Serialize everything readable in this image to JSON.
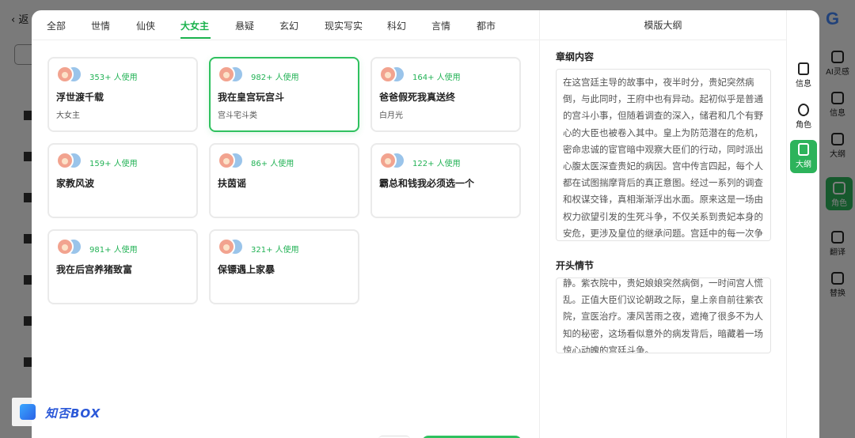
{
  "background": {
    "back_label": "返",
    "google_letter": "G",
    "rail": [
      {
        "label": "AI灵感"
      },
      {
        "label": "信息"
      },
      {
        "label": "大纲"
      },
      {
        "label": "角色"
      },
      {
        "label": "翻译"
      },
      {
        "label": "替换"
      }
    ]
  },
  "tabs": [
    {
      "label": "全部"
    },
    {
      "label": "世情"
    },
    {
      "label": "仙侠"
    },
    {
      "label": "大女主"
    },
    {
      "label": "悬疑"
    },
    {
      "label": "玄幻"
    },
    {
      "label": "现实写实"
    },
    {
      "label": "科幻"
    },
    {
      "label": "言情"
    },
    {
      "label": "都市"
    }
  ],
  "active_tab": "大女主",
  "accent_color": "#2fc15f",
  "cards": [
    {
      "usage": "353+ 人使用",
      "title": "浮世渡千载",
      "tag": "大女主"
    },
    {
      "usage": "982+ 人使用",
      "title": "我在皇宫玩宫斗",
      "tag": "宫斗宅斗类",
      "selected": true
    },
    {
      "usage": "164+ 人使用",
      "title": "爸爸假死我真送终",
      "tag": "白月光"
    },
    {
      "usage": "159+ 人使用",
      "title": "家教风波",
      "tag": ""
    },
    {
      "usage": "86+ 人使用",
      "title": "扶茵谣",
      "tag": ""
    },
    {
      "usage": "122+ 人使用",
      "title": "霸总和钱我必须选一个",
      "tag": ""
    },
    {
      "usage": "981+ 人使用",
      "title": "我在后宫养猪致富",
      "tag": ""
    },
    {
      "usage": "321+ 人使用",
      "title": "保镖遇上家暴",
      "tag": ""
    }
  ],
  "panel": {
    "title": "模版大纲",
    "outline_label": "章纲内容",
    "outline_text": "在这宫廷主导的故事中，夜半时分，贵妃突然病倒，与此同时，王府中也有异动。起初似乎是普通的宫斗小事，但随着调查的深入，储君和几个有野心的大臣也被卷入其中。皇上为防范潜在的危机，密命忠诚的宦官暗中观察大臣们的行动，同时派出心腹太医深查贵妃的病因。宫中传言四起，每个人都在试图揣摩背后的真正意图。经过一系列的调查和权谋交锋，真相渐渐浮出水面。原来这是一场由权力欲望引发的生死斗争，不仅关系到贵妃本身的安危，更涉及皇位的继承问题。宫廷中的每一次争斗，都诉说着人性的贪婪与恐惧，最终在一场突如其来的御花园秘密聚会",
    "opening_label": "开头情节",
    "opening_text": "静。紫衣院中，贵妃娘娘突然病倒，一时间宫人慌乱。正值大臣们议论朝政之际，皇上亲自前往紫衣院，宣医治疗。凄风苦雨之夜，遮掩了很多不为人知的秘密，这场看似意外的病发背后，暗藏着一场惊心动魄的宫廷斗争。"
  },
  "rail": [
    {
      "label": "信息"
    },
    {
      "label": "角色"
    },
    {
      "label": "大纲",
      "active": true
    }
  ],
  "watermark": {
    "text": "知否BOX"
  }
}
